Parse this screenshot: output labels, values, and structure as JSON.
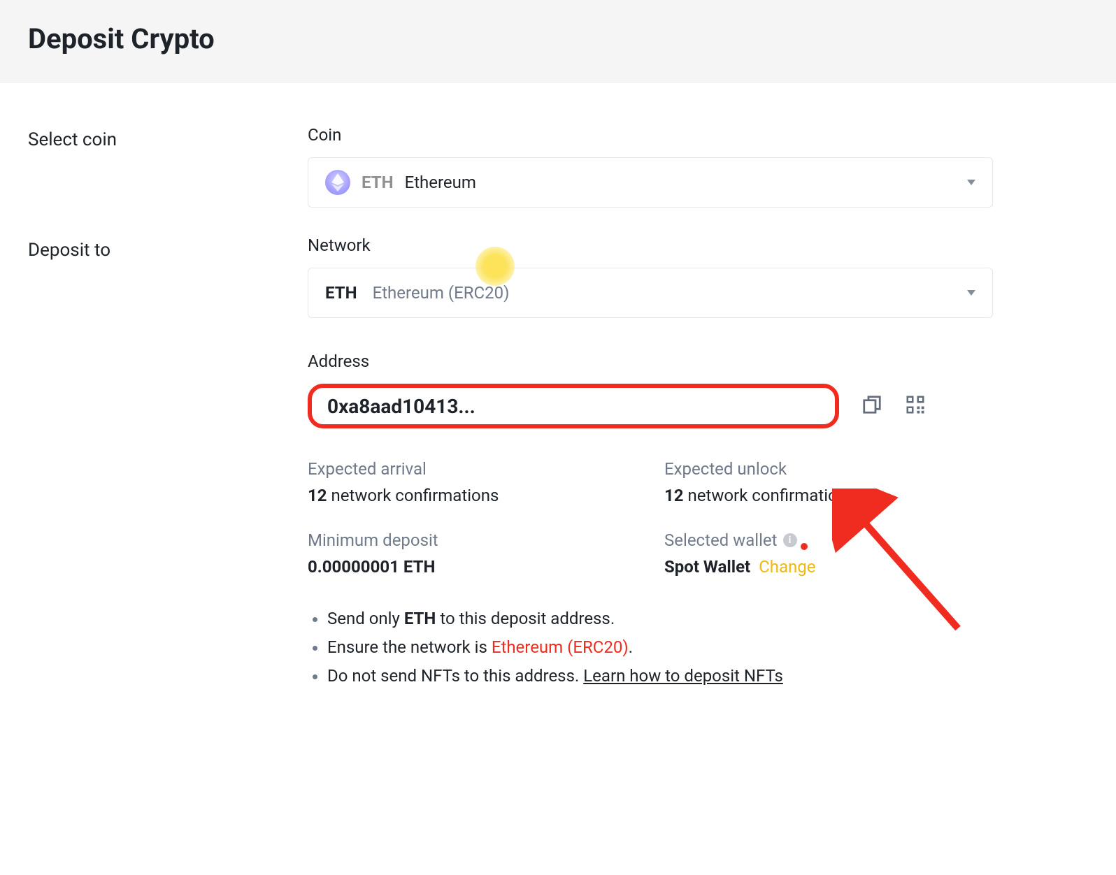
{
  "header": {
    "title": "Deposit Crypto"
  },
  "section_labels": {
    "select_coin": "Select coin",
    "deposit_to": "Deposit to"
  },
  "coin": {
    "label": "Coin",
    "symbol": "ETH",
    "name": "Ethereum"
  },
  "network": {
    "label": "Network",
    "symbol": "ETH",
    "name": "Ethereum (ERC20)"
  },
  "address": {
    "label": "Address",
    "value": "0xa8aad10413..."
  },
  "icons": {
    "copy": "copy-icon",
    "qr": "qr-icon"
  },
  "info": {
    "expected_arrival": {
      "label": "Expected arrival",
      "count": "12",
      "suffix": "network confirmations"
    },
    "expected_unlock": {
      "label": "Expected unlock",
      "count": "12",
      "suffix": "network confirmations"
    },
    "min_deposit": {
      "label": "Minimum deposit",
      "value": "0.00000001 ETH"
    },
    "selected_wallet": {
      "label": "Selected wallet",
      "value": "Spot Wallet",
      "change_label": "Change"
    }
  },
  "notes": {
    "item1_pre": "Send only ",
    "item1_strong": "ETH",
    "item1_post": " to this deposit address.",
    "item2_pre": "Ensure the network is ",
    "item2_highlight": "Ethereum (ERC20)",
    "item2_post": ".",
    "item3_pre": "Do not send NFTs to this address. ",
    "item3_link": "Learn how to deposit NFTs"
  }
}
